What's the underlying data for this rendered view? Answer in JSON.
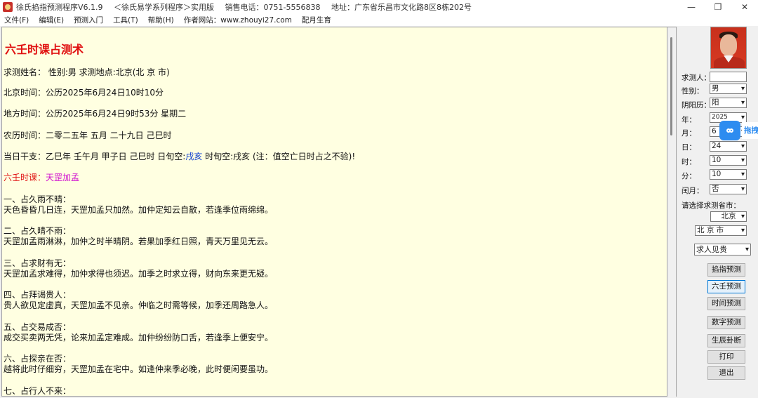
{
  "window": {
    "title_parts": [
      "徐氏掐指预测程序V6.1.9",
      "＜徐氏易学系列程序＞实用版",
      "销售电话：0751-5556838",
      "地址：广东省乐昌市文化路8区8栋202号"
    ],
    "minimize": "—",
    "restore": "❐",
    "close": "✕"
  },
  "menu": [
    "文件(F)",
    "编辑(E)",
    "预测入门",
    "工具(T)",
    "帮助(H)",
    "作者网站：www.zhouyi27.com",
    "配月生育"
  ],
  "content": {
    "title": "六壬时课占测术",
    "name_line": "求测姓名： 性别:男  求测地点:北京(北 京 市)",
    "beijing_time": "北京时间：公历2025年6月24日10时10分",
    "local_time": "地方时间：公历2025年6月24日9时53分 星期二",
    "lunar_time": "农历时间：二零二五年 五月 二十九日 己巳时",
    "ganzhi_prefix": "当日干支：乙巳年 壬午月 甲子日 己巳时  日旬空:",
    "ganzhi_blue": "戌亥",
    "ganzhi_suffix": " 时旬空:戌亥 (注：值空亡日时占之不验)!",
    "lesson_label": "六壬时课：",
    "lesson_value": "天罡加孟",
    "items": [
      {
        "head": "一、占久雨不晴：",
        "body": "天色昏昏几日连，天罡加孟只加然。加仲定知云自散，若逢季位雨绵绵。"
      },
      {
        "head": "二、占久晴不雨：",
        "body": "天罡加孟雨淋淋，加仲之时半晴阴。若果加季红日照，青天万里见无云。"
      },
      {
        "head": "三、占求财有无：",
        "body": "天罡加孟求难得，加仲求得也须迟。加季之时求立得，财向东来更无疑。"
      },
      {
        "head": "四、占拜谒贵人：",
        "body": "贵人欲见定虚真，天罡加孟不见亲。仲临之时需等候，加季还周路急人。"
      },
      {
        "head": "五、占交易成否：",
        "body": "成交买卖两无凭，论来加孟定难成。加仲纷纷防口舌，若逢季上便安宁。"
      },
      {
        "head": "六、占探亲在否：",
        "body": "越将此时仔细穷，天罡加孟在宅中。如逢仲来季必晚，此时便闲要虽功。"
      },
      {
        "head": "七、占行人不来：",
        "body": ""
      }
    ]
  },
  "panel": {
    "asker_label": "求测人：",
    "asker_value": "",
    "gender_label": "性别：",
    "gender_value": "男",
    "calendar_label": "阴阳历：",
    "calendar_value": "阳",
    "year_label": "年：",
    "year_value": "2025",
    "month_label": "月：",
    "month_value": "6",
    "day_label": "日：",
    "day_value": "24",
    "hour_label": "时：",
    "hour_value": "10",
    "minute_label": "分：",
    "minute_value": "10",
    "leap_label": "闰月：",
    "leap_value": "否",
    "city_prompt": "请选择求测省市：",
    "province": "北京",
    "city": "北 京 市",
    "topic": "求人见贵",
    "buttons": [
      "掐指预测",
      "六壬预测",
      "时间预测",
      "数字预测",
      "生辰卦断",
      "打印",
      "退出"
    ]
  },
  "floating": {
    "text": "拖拽"
  }
}
